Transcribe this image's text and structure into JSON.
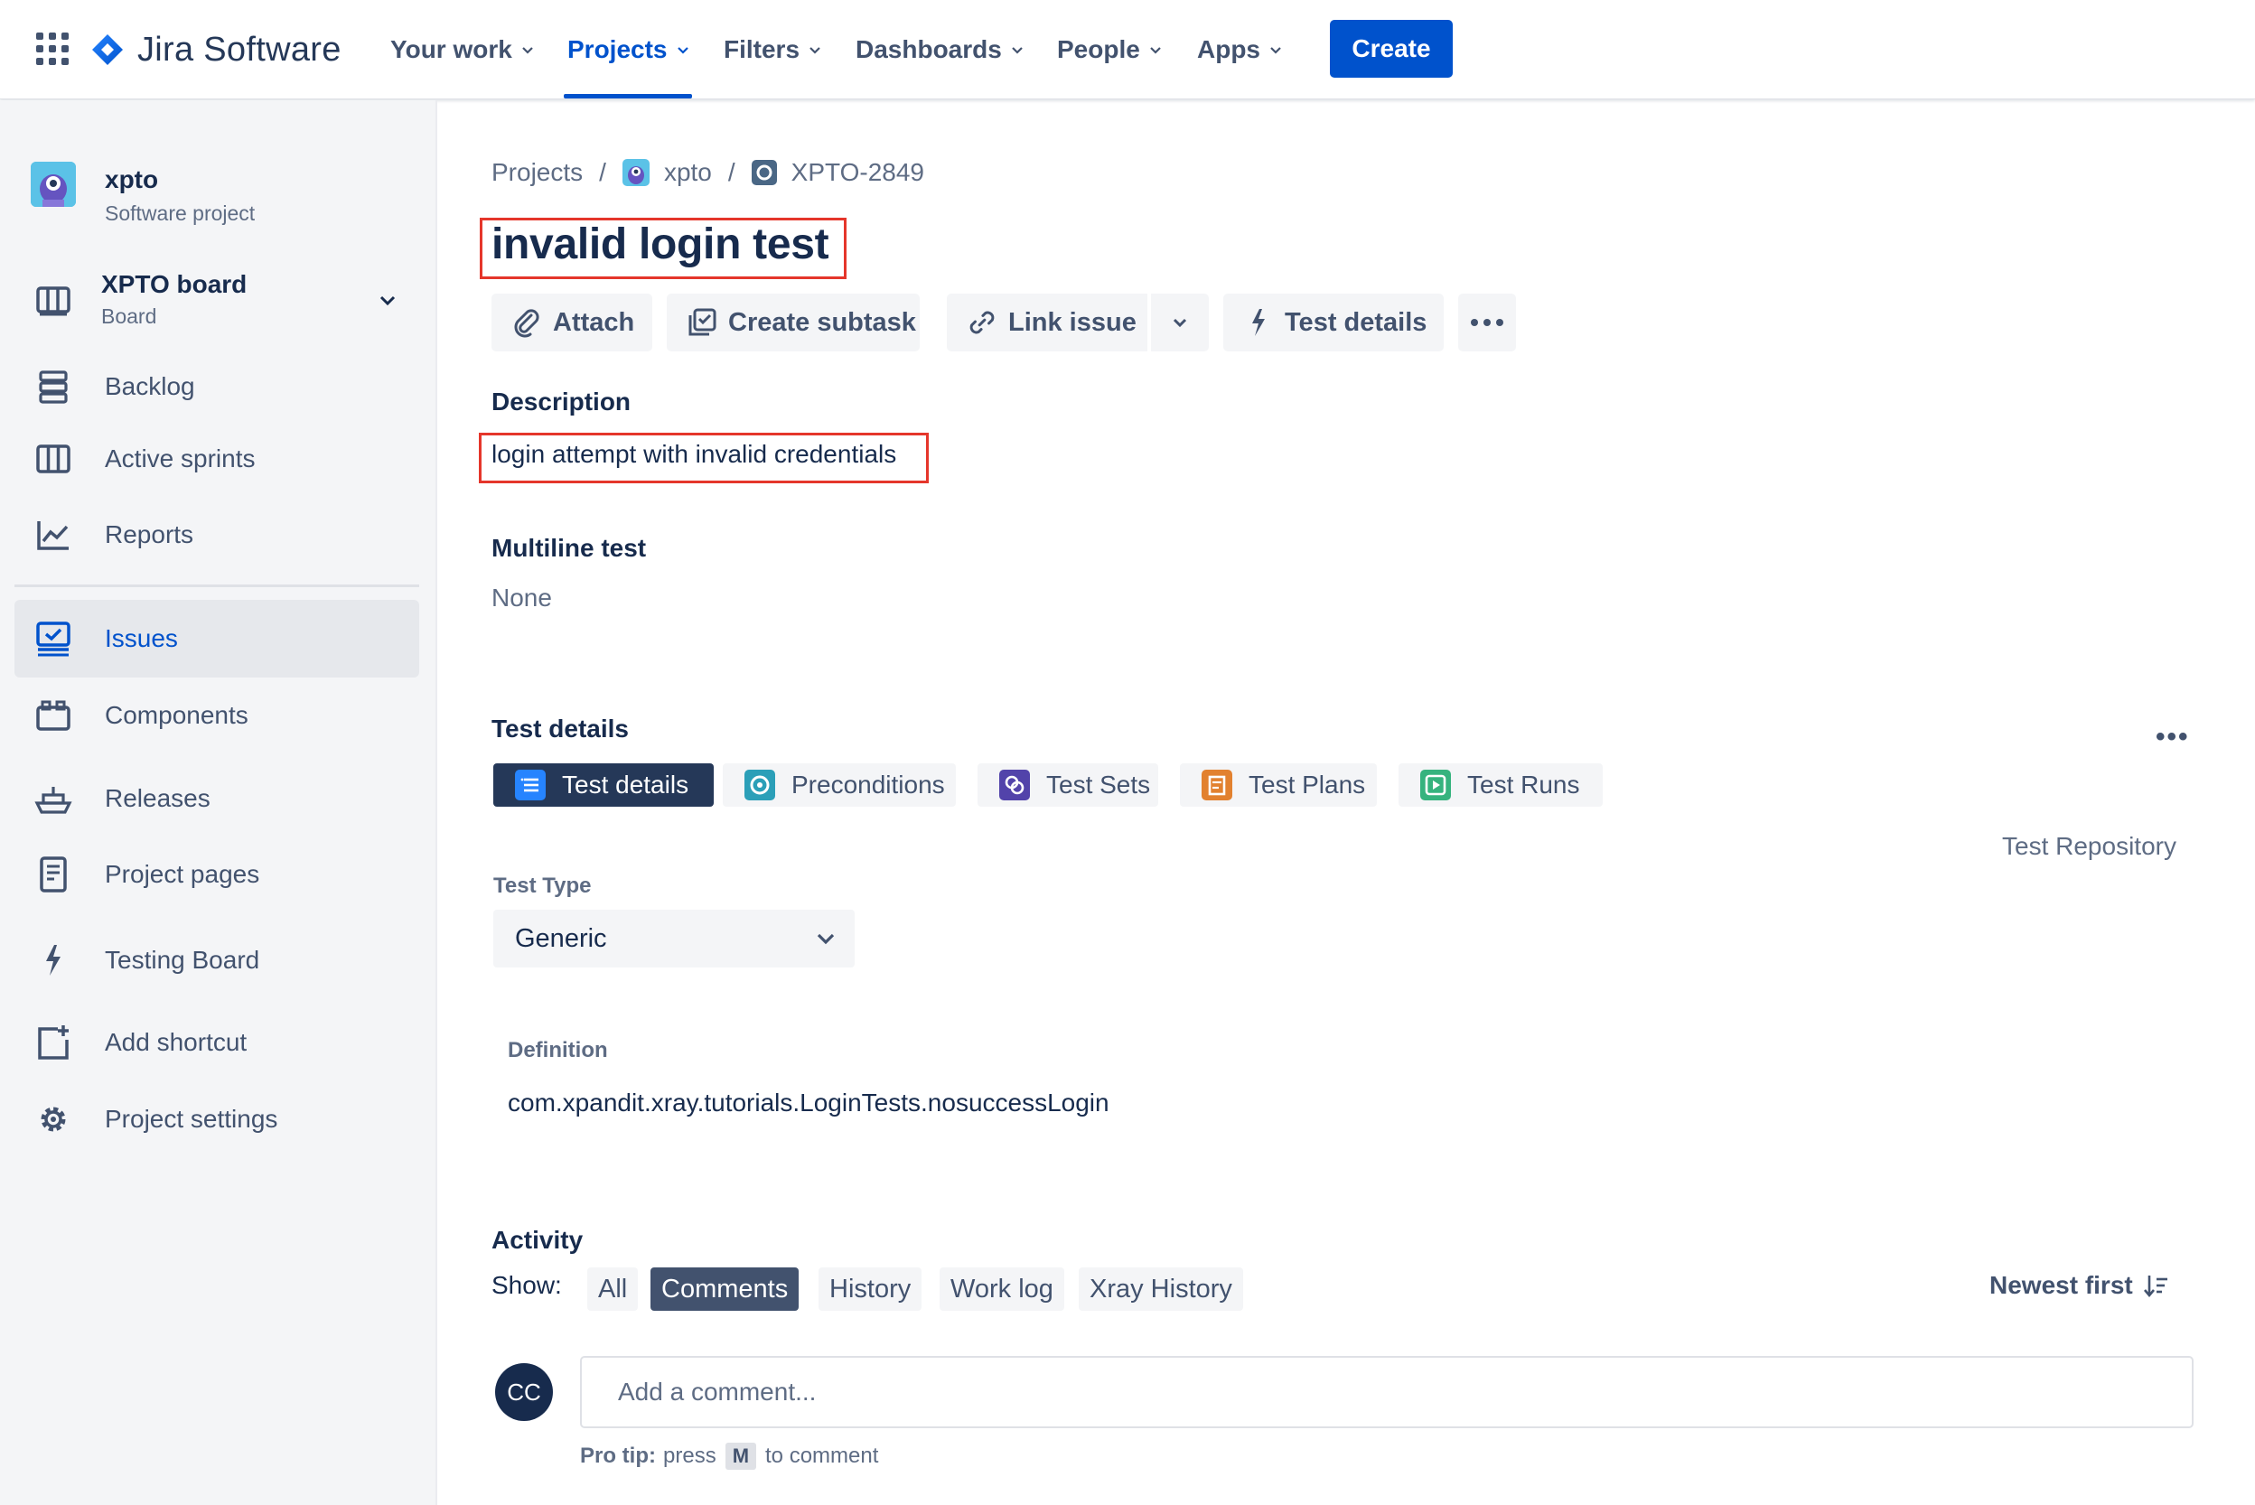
{
  "topnav": {
    "logo_text": "Jira Software",
    "items": [
      {
        "label": "Your work"
      },
      {
        "label": "Projects"
      },
      {
        "label": "Filters"
      },
      {
        "label": "Dashboards"
      },
      {
        "label": "People"
      },
      {
        "label": "Apps"
      }
    ],
    "create_label": "Create"
  },
  "sidebar": {
    "project_name": "xpto",
    "project_type": "Software project",
    "board_name": "XPTO board",
    "board_sub": "Board",
    "items": [
      {
        "label": "Backlog"
      },
      {
        "label": "Active sprints"
      },
      {
        "label": "Reports"
      },
      {
        "label": "Issues"
      },
      {
        "label": "Components"
      },
      {
        "label": "Releases"
      },
      {
        "label": "Project pages"
      },
      {
        "label": "Testing Board"
      },
      {
        "label": "Add shortcut"
      },
      {
        "label": "Project settings"
      }
    ]
  },
  "breadcrumb": {
    "projects": "Projects",
    "sep": "/",
    "project": "xpto",
    "issue_key": "XPTO-2849"
  },
  "issue": {
    "title": "invalid login test",
    "toolbar": {
      "attach": "Attach",
      "create_subtask": "Create subtask",
      "link_issue": "Link issue",
      "test_details": "Test details"
    },
    "description_label": "Description",
    "description": "login attempt with invalid credentials",
    "multiline_label": "Multiline test",
    "multiline_value": "None"
  },
  "test_details": {
    "heading": "Test details",
    "more": "•••",
    "tabs": [
      {
        "label": "Test details"
      },
      {
        "label": "Preconditions"
      },
      {
        "label": "Test Sets"
      },
      {
        "label": "Test Plans"
      },
      {
        "label": "Test Runs"
      }
    ],
    "test_repository": "Test Repository",
    "test_type_label": "Test Type",
    "test_type_value": "Generic",
    "definition_label": "Definition",
    "definition_value": "com.xpandit.xray.tutorials.LoginTests.nosuccessLogin"
  },
  "activity": {
    "heading": "Activity",
    "show_label": "Show:",
    "filters": [
      {
        "label": "All"
      },
      {
        "label": "Comments"
      },
      {
        "label": "History"
      },
      {
        "label": "Work log"
      },
      {
        "label": "Xray History"
      }
    ],
    "sort_label": "Newest first",
    "avatar_initials": "CC",
    "comment_placeholder": "Add a comment...",
    "pro_tip_bold": "Pro tip:",
    "pro_tip_press": "press",
    "pro_tip_key": "M",
    "pro_tip_suffix": "to comment"
  },
  "colors": {
    "brand_blue": "#0052cc",
    "highlight_box": "#e5362b",
    "sidebar_bg": "#f4f5f7",
    "active_tab_bg": "#253858"
  }
}
